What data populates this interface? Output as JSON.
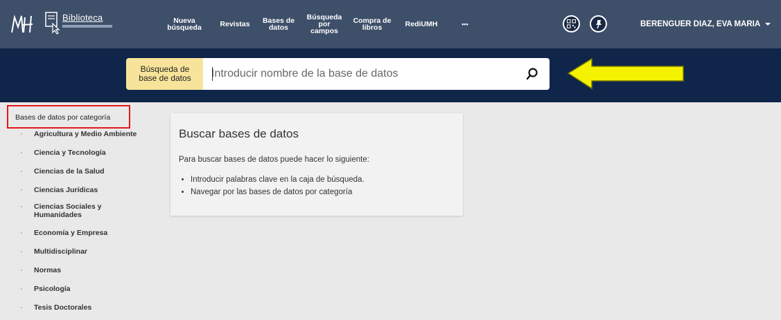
{
  "header": {
    "logo_text": "Biblioteca",
    "nav": [
      {
        "label": "Nueva\nbúsqueda"
      },
      {
        "label": "Revistas"
      },
      {
        "label": "Bases de\ndatos"
      },
      {
        "label": "Búsqueda\npor\ncampos"
      },
      {
        "label": "Compra de\nlibros"
      },
      {
        "label": "RediUMH"
      },
      {
        "label": "•••"
      }
    ],
    "user_name": "BERENGUER DIAZ, EVA MARIA"
  },
  "search": {
    "label": "Búsqueda de\nbase de datos",
    "placeholder": "Introducir nombre de la base de datos",
    "value": ""
  },
  "sidebar": {
    "title": "Bases de datos por categoría",
    "categories": [
      {
        "label": "Agricultura y Medio Ambiente"
      },
      {
        "label": "Ciencia y Tecnología"
      },
      {
        "label": "Ciencias de la Salud"
      },
      {
        "label": "Ciencias Jurídicas"
      },
      {
        "label": "Ciencias Sociales y\nHumanidades"
      },
      {
        "label": "Economía y Empresa"
      },
      {
        "label": "Multidisciplinar"
      },
      {
        "label": "Normas"
      },
      {
        "label": "Psicología"
      },
      {
        "label": "Tesis Doctorales"
      }
    ]
  },
  "panel": {
    "title": "Buscar bases de datos",
    "intro": "Para buscar bases de datos puede hacer lo siguiente:",
    "bullets": [
      "Introducir palabras clave en la caja de búsqueda.",
      "Navegar por las bases de datos por categoría"
    ]
  },
  "colors": {
    "nav_bg": "#3e4f69",
    "search_band_bg": "#0f2549",
    "label_bg": "#f7e49a",
    "highlight_box": "#e4161b",
    "arrow": "#f5f200"
  },
  "icons": {
    "search": "magnifier-icon",
    "qr": "qr-code-icon",
    "pin": "pin-icon",
    "arrow": "yellow-arrow-annotation"
  }
}
